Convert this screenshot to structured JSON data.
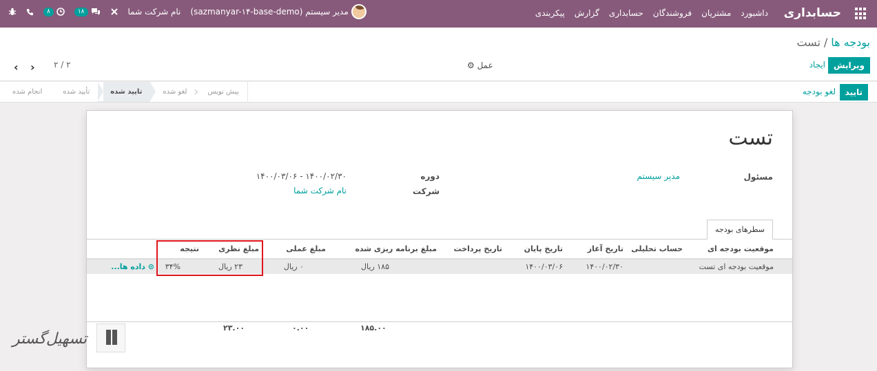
{
  "navbar": {
    "brand": "حسابداری",
    "menu": [
      "داشبورد",
      "مشتریان",
      "فروشندگان",
      "حسابداری",
      "گزارش",
      "پیکربندی"
    ],
    "user": "مدیر سیستم (sazmanyar-۱۴-base-demo)",
    "company": "نام شرکت شما",
    "messages_count": "۱۸",
    "activities_count": "۸"
  },
  "control_panel": {
    "breadcrumb_parent": "بودجه ها",
    "breadcrumb_sep": "/",
    "breadcrumb_current": "تست",
    "edit_label": "ویرایش",
    "create_label": "ایجاد",
    "action_label": "⚙ عمل",
    "pager_value": "۲ / ۲"
  },
  "statusbar": {
    "confirm_label": "تایید",
    "cancel_label": "لغو بودجه",
    "steps": [
      "پیش نویس",
      "لغو شده",
      "تایید شده",
      "تأیید شده",
      "انجام شده"
    ],
    "active_step": "تایید شده"
  },
  "form": {
    "title": "تست",
    "responsible_label": "مسئول",
    "responsible_value": "مدیر سیستم",
    "period_label": "دوره",
    "period_value": "۱۴۰۰/۰۲/۳۰ - ۱۴۰۰/۰۳/۰۶",
    "company_label": "شرکت",
    "company_value": "نام شرکت شما",
    "tab_label": "سطرهای بودجه"
  },
  "budget_lines": {
    "headers": {
      "position": "موقعیت بودجه ای",
      "analytic": "حساب تحلیلی",
      "start": "تاریخ آغاز",
      "end": "تاریخ پایان",
      "paid": "تاریخ پرداخت",
      "planned": "مبلغ برنامه ریزی شده",
      "practical": "مبلغ عملی",
      "theoretical": "مبلغ نظری",
      "result": "نتیجه"
    },
    "rows": [
      {
        "position": "موقعیت بودجه ای تست",
        "analytic": "",
        "start": "۱۴۰۰/۰۲/۳۰",
        "end": "۱۴۰۰/۰۳/۰۶",
        "paid": "",
        "planned": "۱۸۵ ریال",
        "practical": "۰ ریال",
        "theoretical": "۲۳ ریال",
        "result": "۳۴%",
        "details_link": "⊙ داده ها..."
      }
    ],
    "totals": {
      "planned": "۱۸۵.۰۰",
      "practical": "۰.۰۰",
      "theoretical": "۲۳.۰۰"
    }
  },
  "watermark": {
    "text": "تسهیل‌گستر"
  },
  "colors": {
    "navbar": "#875a7b",
    "primary": "#00a09d",
    "highlight": "#e0141c"
  }
}
